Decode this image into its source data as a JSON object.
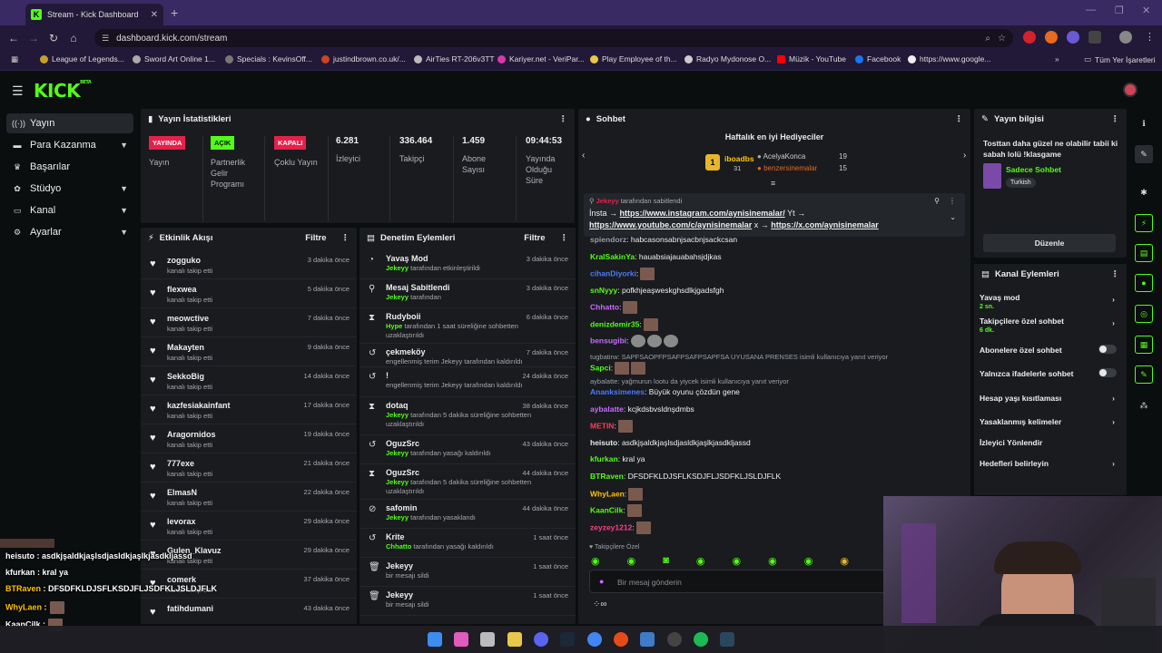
{
  "browser": {
    "tab_title": "Stream - Kick Dashboard",
    "url": "dashboard.kick.com/stream",
    "bookmarks": [
      "League of Legends...",
      "Sword Art Online 1...",
      "Specials : KevinsOff...",
      "justindbrown.co.uk/...",
      "AirTies RT-206v3TT",
      "Kariyer.net - VeriPar...",
      "Play Employee of th...",
      "Radyo Mydonose O...",
      "Müzik - YouTube",
      "Facebook",
      "https://www.google..."
    ],
    "all_bookmarks": "Tüm Yer İşaretleri"
  },
  "sidebar": {
    "items": [
      {
        "label": "Yayın",
        "icon": "broadcast-icon",
        "chev": ""
      },
      {
        "label": "Para Kazanma",
        "icon": "money-icon",
        "chev": "▼"
      },
      {
        "label": "Başarılar",
        "icon": "trophy-icon",
        "chev": ""
      },
      {
        "label": "Stüdyo",
        "icon": "studio-icon",
        "chev": "▼"
      },
      {
        "label": "Kanal",
        "icon": "channel-icon",
        "chev": "▼"
      },
      {
        "label": "Ayarlar",
        "icon": "gear-icon",
        "chev": "▼"
      }
    ]
  },
  "stats": {
    "title": "Yayın İstatistikleri",
    "cols": [
      {
        "badge": "YAYINDA",
        "label": "Yayın"
      },
      {
        "badge": "AÇIK",
        "label": "Partnerlik Gelir Programı"
      },
      {
        "badge": "KAPALI",
        "label": "Çoklu Yayın"
      },
      {
        "value": "6.281",
        "label": "İzleyici"
      },
      {
        "value": "336.464",
        "label": "Takipçi"
      },
      {
        "value": "1.459",
        "label": "Abone Sayısı"
      },
      {
        "value": "09:44:53",
        "label": "Yayında Olduğu Süre"
      }
    ]
  },
  "activity": {
    "title": "Etkinlik Akışı",
    "filter": "Filtre",
    "rows": [
      {
        "name": "zogguko",
        "sub": "kanalı takip etti",
        "time": "3 dakika önce"
      },
      {
        "name": "flexwea",
        "sub": "kanalı takip etti",
        "time": "5 dakika önce"
      },
      {
        "name": "meowctive",
        "sub": "kanalı takip etti",
        "time": "7 dakika önce"
      },
      {
        "name": "Makayten",
        "sub": "kanalı takip etti",
        "time": "9 dakika önce"
      },
      {
        "name": "SekkoBig",
        "sub": "kanalı takip etti",
        "time": "14 dakika önce"
      },
      {
        "name": "kazfesiakainfant",
        "sub": "kanalı takip etti",
        "time": "17 dakika önce"
      },
      {
        "name": "Aragornidos",
        "sub": "kanalı takip etti",
        "time": "19 dakika önce"
      },
      {
        "name": "777exe",
        "sub": "kanalı takip etti",
        "time": "21 dakika önce"
      },
      {
        "name": "ElmasN",
        "sub": "kanalı takip etti",
        "time": "22 dakika önce"
      },
      {
        "name": "levorax",
        "sub": "kanalı takip etti",
        "time": "29 dakika önce"
      },
      {
        "name": "Gulen_Klavuz",
        "sub": "kanalı takip etti",
        "time": "29 dakika önce"
      },
      {
        "name": "comerk",
        "sub": "kanalı takip etti",
        "time": "37 dakika önce"
      },
      {
        "name": "fatihdumani",
        "sub": "",
        "time": "43 dakika önce"
      }
    ]
  },
  "moderation": {
    "title": "Denetim Eylemleri",
    "filter": "Filtre",
    "rows": [
      {
        "icon": "slow-icon",
        "glyph": "◔",
        "name": "Yavaş Mod",
        "user": "Jekeyy",
        "sub": " tarafından etkinleştirildi",
        "time": "3 dakika önce"
      },
      {
        "icon": "pin-icon",
        "glyph": "⚲",
        "name": "Mesaj Sabitlendi",
        "user": "Jekeyy",
        "sub": " tarafından",
        "time": "3 dakika önce"
      },
      {
        "icon": "hourglass-icon",
        "glyph": "⧗",
        "name": "Rudyboii",
        "user": "Hype",
        "sub": " tarafından 1 saat süreliğine sohbetten uzaklaştırıldı",
        "time": "6 dakika önce"
      },
      {
        "icon": "undo-icon",
        "glyph": "↺",
        "name": "çekmeköy",
        "user": "",
        "sub": "engellenmiş terim Jekeyy tarafından kaldırıldı",
        "time": "7 dakika önce"
      },
      {
        "icon": "undo-icon",
        "glyph": "↺",
        "name": "!",
        "user": "",
        "sub": "engellenmiş terim Jekeyy tarafından kaldırıldı",
        "time": "24 dakika önce"
      },
      {
        "icon": "hourglass-icon",
        "glyph": "⧗",
        "name": "dotaq",
        "user": "Jekeyy",
        "sub": " tarafından 5 dakika süreliğine sohbetten uzaklaştırıldı",
        "time": "38 dakika önce"
      },
      {
        "icon": "undo-icon",
        "glyph": "↺",
        "name": "OguzSrc",
        "user": "Jekeyy",
        "sub": " tarafından yasağı kaldırıldı",
        "time": "43 dakika önce"
      },
      {
        "icon": "hourglass-icon",
        "glyph": "⧗",
        "name": "OguzSrc",
        "user": "Jekeyy",
        "sub": " tarafından 5 dakika süreliğine sohbetten uzaklaştırıldı",
        "time": "44 dakika önce"
      },
      {
        "icon": "ban-icon",
        "glyph": "⊘",
        "name": "safomin",
        "user": "Jekeyy",
        "sub": " tarafından yasaklandı",
        "time": "44 dakika önce"
      },
      {
        "icon": "undo-icon",
        "glyph": "↺",
        "name": "Krite",
        "user": "Chhatto",
        "sub": " tarafından yasağı kaldırıldı",
        "time": "1 saat önce"
      },
      {
        "icon": "trash-icon",
        "glyph": "🗑",
        "name": "Jekeyy",
        "user": "",
        "sub": "bir mesajı sildi",
        "time": "1 saat önce"
      },
      {
        "icon": "trash-icon",
        "glyph": "🗑",
        "name": "Jekeyy",
        "user": "",
        "sub": "bir mesajı sildi",
        "time": "1 saat önce"
      }
    ]
  },
  "chat": {
    "title": "Sohbet",
    "gifters_title": "Haftalık en iyi Hediyeciler",
    "gifters": [
      {
        "rank": "1",
        "name": "iboadbs",
        "count": "31"
      },
      {
        "name": "AcelyaKonca",
        "count": "19"
      },
      {
        "name": "benzersinemalar",
        "count": "15"
      }
    ],
    "pinned": {
      "user": "Jekeyy",
      "by": " tarafından sabitlendi",
      "line1_prefix": "İnsta → ",
      "line1_link": "https://www.instagram.com/aynisinemalar/",
      "line1_suffix": " Yt →",
      "line2_link": "https://www.youtube.com/c/aynisinemalar",
      "line2_mid": " x → ",
      "line2_link2": "https://x.com/aynisinemalar"
    },
    "messages": [
      {
        "user": "spiendorz",
        "color": "#9aa0a6",
        "text": ": habcasonsabnjsacbnjsackcsan"
      },
      {
        "user": "KralSakinYa",
        "color": "#53fc18",
        "text": ": hauabsiajauabahsjdjkas"
      },
      {
        "user": "cihanDiyorki",
        "color": "#4a7bff",
        "text": ":"
      },
      {
        "user": "snNyyy",
        "color": "#53fc18",
        "text": ": pofkhjeaşweskghsdlkjgadsfgh"
      },
      {
        "user": "Chhatto",
        "color": "#c86bff",
        "text": ":"
      },
      {
        "user": "denizdemir35",
        "color": "#53fc18",
        "text": ":"
      },
      {
        "user": "bensugibi",
        "color": "#c86bff",
        "text": ":"
      },
      {
        "user": "Sapci",
        "color": "#53fc18",
        "text": ":"
      },
      {
        "user": "Ananksimenes",
        "color": "#4a7bff",
        "text": ": Büyük oyunu çözdün gene"
      },
      {
        "user": "aybalatte",
        "color": "#c86bff",
        "text": ": kcjkdsbvsldnşdmbs"
      },
      {
        "user": "METIN",
        "color": "#ff3c5a",
        "text": ":"
      },
      {
        "user": "heisuto",
        "color": "#e8e8e8",
        "text": ": asdkjşaldkjaşlsdjasldkjaşlkjasdkljassd"
      },
      {
        "user": "kfurkan",
        "color": "#53fc18",
        "text": ": kral ya"
      },
      {
        "user": "BTRaven",
        "color": "#53fc18",
        "text": ": DFSDFKLDJSFLKSDJFLJSDFKLJSLDJFLK"
      },
      {
        "user": "WhyLaen",
        "color": "#ffc400",
        "text": ":"
      },
      {
        "user": "KaanCilk",
        "color": "#53fc18",
        "text": ":"
      },
      {
        "user": "zeyzey1212",
        "color": "#ff3c8a",
        "text": ":"
      }
    ],
    "reply1": "tugbatirw: SAPFSAOPFPSAFPSAFPSAPFSA UYUSANA PRENSES isimli kullanıcıya yanıt veriyor",
    "reply2": "aybalatte: yağmurun lootu da yiycek isimli kullanıcıya yanıt veriyor",
    "followers_only": "Takipçilere Özel",
    "input_placeholder": "Bir mesaj gönderin"
  },
  "stream_info": {
    "title": "Yayın bilgisi",
    "desc": "Tosttan daha güzel ne olabilir tabii ki sabah lolü !klasgame",
    "category": "Sadece Sohbet",
    "tag": "Turkish",
    "edit": "Düzenle"
  },
  "channel_actions": {
    "title": "Kanal Eylemleri",
    "items": [
      {
        "label": "Yavaş mod",
        "sub": "2 sn.",
        "kind": "arrow"
      },
      {
        "label": "Takipçilere özel sohbet",
        "sub": "6 dk.",
        "kind": "arrow"
      },
      {
        "label": "Abonelere özel sohbet",
        "sub": "",
        "kind": "toggle"
      },
      {
        "label": "Yalnızca ifadelerle sohbet",
        "sub": "",
        "kind": "toggle"
      },
      {
        "label": "Hesap yaşı kısıtlaması",
        "sub": "",
        "kind": "arrow"
      },
      {
        "label": "Yasaklanmış kelimeler",
        "sub": "",
        "kind": "arrow"
      },
      {
        "label": "İzleyici Yönlendir",
        "sub": "",
        "kind": "none"
      },
      {
        "label": "Hedefleri belirleyin",
        "sub": "",
        "kind": "arrow"
      }
    ]
  },
  "overlay_chat": [
    {
      "user": "heisuto",
      "color": "#ffffff",
      "text": " : asdkjşaldkjaşlsdjasldkjaşlkjasdkljassd"
    },
    {
      "user": "kfurkan",
      "color": "#ffffff",
      "text": " : kral ya"
    },
    {
      "user": "BTRaven",
      "color": "#ffc400",
      "text": " : DFSDFKLDJSFLKSDJFLJSDFKLJSLDJFLK"
    },
    {
      "user": "WhyLaen",
      "color": "#ffc400",
      "text": " :"
    },
    {
      "user": "KaanCilk",
      "color": "#ffffff",
      "text": " :"
    }
  ],
  "colors": {
    "accent": "#53fc18",
    "live": "#e4214b",
    "panel": "#191b1f",
    "bg": "#0b0e0f"
  }
}
